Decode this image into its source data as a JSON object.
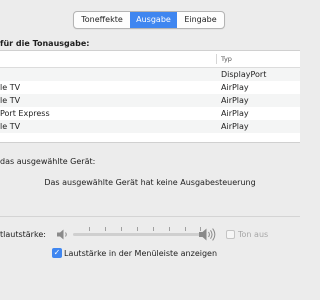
{
  "tabs": [
    {
      "label": "Toneffekte",
      "active": false
    },
    {
      "label": "Ausgabe",
      "active": true
    },
    {
      "label": "Eingabe",
      "active": false
    }
  ],
  "section_heading": "für die Tonausgabe:",
  "table": {
    "columns": [
      "",
      "Typ"
    ],
    "rows": [
      {
        "name": "",
        "type": "DisplayPort"
      },
      {
        "name": "le TV",
        "type": "AirPlay"
      },
      {
        "name": "le TV",
        "type": "AirPlay"
      },
      {
        "name": "Port Express",
        "type": "AirPlay"
      },
      {
        "name": "le TV",
        "type": "AirPlay"
      }
    ]
  },
  "settings_label": "das ausgewählte Gerät:",
  "no_controls_message": "Das ausgewählte Gerät hat keine Ausgabesteuerung",
  "volume": {
    "label": "tlautstärke:",
    "level": 0.0,
    "mute_label": "Ton aus",
    "mute_checked": false,
    "mute_enabled": false
  },
  "menubar": {
    "label": "Lautstärke in der Menüleiste anzeigen",
    "checked": true
  },
  "icons": {
    "speaker_low": "speaker-low-icon",
    "speaker_high": "speaker-high-icon",
    "checkmark": "checkmark-icon"
  },
  "colors": {
    "accent": "#3f86f0",
    "window_bg": "#ececec",
    "disabled_text": "#a6a6a6"
  }
}
